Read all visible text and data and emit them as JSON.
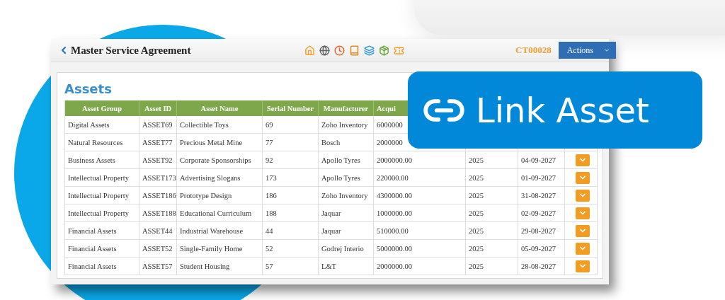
{
  "header": {
    "title": "Master Service Agreement",
    "code": "CT00028",
    "actions_button": "Actions"
  },
  "panel": {
    "title": "Assets"
  },
  "table": {
    "columns": [
      "Asset Group",
      "Asset ID",
      "Asset Name",
      "Serial Number",
      "Manufacturer",
      "Acqui"
    ],
    "rows": [
      {
        "group": "Digital Assets",
        "id": "ASSET69",
        "name": "Collectible Toys",
        "serial": "69",
        "manufacturer": "Zoho Inventory",
        "value": "6000000"
      },
      {
        "group": "Natural Resources",
        "id": "ASSET77",
        "name": "Precious Metal Mine",
        "serial": "77",
        "manufacturer": "Bosch",
        "value": "2000000"
      },
      {
        "group": "Business Assets",
        "id": "ASSET92",
        "name": "Corporate Sponsorships",
        "serial": "92",
        "manufacturer": "Apollo Tyres",
        "value": "2000000.00",
        "year": "2025",
        "date": "04-09-2027",
        "menu": true
      },
      {
        "group": "Intellectual Property",
        "id": "ASSET173",
        "name": "Advertising Slogans",
        "serial": "173",
        "manufacturer": "Apollo Tyres",
        "value": "220000.00",
        "year": "2025",
        "date": "01-09-2027",
        "menu": true
      },
      {
        "group": "Intellectual Property",
        "id": "ASSET186",
        "name": "Prototype Design",
        "serial": "186",
        "manufacturer": "Zoho Inventory",
        "value": "4300000.00",
        "year": "2025",
        "date": "31-08-2027",
        "menu": true
      },
      {
        "group": "Intellectual Property",
        "id": "ASSET188",
        "name": "Educational Curriculum",
        "serial": "188",
        "manufacturer": "Jaquar",
        "value": "1000000.00",
        "year": "2025",
        "date": "02-09-2027",
        "menu": true
      },
      {
        "group": "Financial Assets",
        "id": "ASSET44",
        "name": "Industrial Warehouse",
        "serial": "44",
        "manufacturer": "Jaquar",
        "value": "510000.00",
        "year": "2025",
        "date": "29-08-2027",
        "menu": true
      },
      {
        "group": "Financial Assets",
        "id": "ASSET52",
        "name": "Single-Family Home",
        "serial": "52",
        "manufacturer": "Godrej Interio",
        "value": "5000000.00",
        "year": "2025",
        "date": "05-09-2027",
        "menu": true
      },
      {
        "group": "Financial Assets",
        "id": "ASSET57",
        "name": "Student Housing",
        "serial": "57",
        "manufacturer": "L&T",
        "value": "2000000.00",
        "year": "2025",
        "date": "28-08-2027",
        "menu": true
      }
    ]
  },
  "banner": {
    "label": "Link Asset"
  }
}
